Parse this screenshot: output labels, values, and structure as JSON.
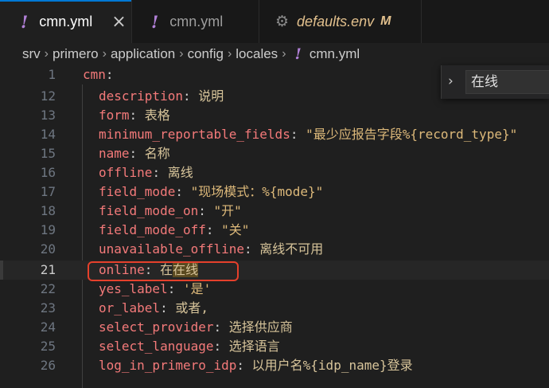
{
  "tabs": [
    {
      "label": "cmn.yml",
      "active": true,
      "close_glyph": "×",
      "icon": "yaml-icon"
    },
    {
      "label": "cmn.yml",
      "active": false,
      "icon": "yaml-icon"
    },
    {
      "label": "defaults.env",
      "active": false,
      "modified": "M",
      "icon": "gear-icon"
    }
  ],
  "breadcrumb": [
    "srv",
    "primero",
    "application",
    "config",
    "locales",
    "cmn.yml"
  ],
  "find": {
    "query": "在线"
  },
  "editor": {
    "root": {
      "num": "1",
      "key": "cmn",
      "punc": ":"
    },
    "lines": [
      {
        "num": "12",
        "key": "description",
        "value": "说明"
      },
      {
        "num": "13",
        "key": "form",
        "value": "表格"
      },
      {
        "num": "14",
        "key": "minimum_reportable_fields",
        "value": "\"最少应报告字段%{record_type}\""
      },
      {
        "num": "15",
        "key": "name",
        "value": "名称"
      },
      {
        "num": "16",
        "key": "offline",
        "value": "离线"
      },
      {
        "num": "17",
        "key": "field_mode",
        "value": "\"现场模式：%{mode}\""
      },
      {
        "num": "18",
        "key": "field_mode_on",
        "value": "\"开\""
      },
      {
        "num": "19",
        "key": "field_mode_off",
        "value": "\"关\""
      },
      {
        "num": "20",
        "key": "unavailable_offline",
        "value": "离线不可用"
      },
      {
        "num": "21",
        "key": "online",
        "value_prefix": "在",
        "value_match": "在线",
        "current": true
      },
      {
        "num": "22",
        "key": "yes_label",
        "value": "'是'"
      },
      {
        "num": "23",
        "key": "or_label",
        "value": "或者,"
      },
      {
        "num": "24",
        "key": "select_provider",
        "value": "选择供应商"
      },
      {
        "num": "25",
        "key": "select_language",
        "value": "选择语言"
      },
      {
        "num": "26",
        "key": "log_in_primero_idp",
        "value": "以用户名%{idp_name}登录"
      }
    ]
  },
  "colors": {
    "accent": "#0078d4",
    "highlight_box": "#e5402b",
    "key": "#f47a7a",
    "value": "#ddb97a"
  }
}
